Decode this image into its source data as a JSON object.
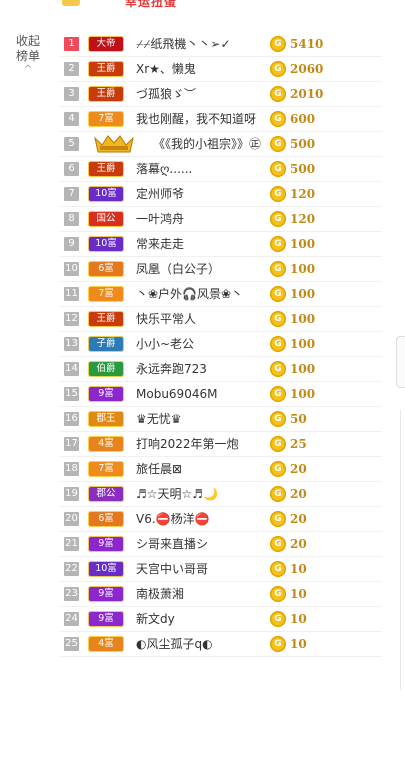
{
  "header": {
    "title": "幸运扭蛋"
  },
  "sidebar": {
    "collapse_label_line1": "收起",
    "collapse_label_line2": "榜单",
    "chevron": "^"
  },
  "coin_glyph": "G",
  "rows": [
    {
      "rank": "1",
      "badge": "大帝",
      "badge_type": "dadi",
      "name": "⌿⌿纸飛機丶丶➢✓",
      "score": "5410"
    },
    {
      "rank": "2",
      "badge": "王爵",
      "badge_type": "wang",
      "name": "Xr★、懒鬼",
      "score": "2060"
    },
    {
      "rank": "3",
      "badge": "王爵",
      "badge_type": "wang",
      "name": "づ孤狼ゞ︶",
      "score": "2010"
    },
    {
      "rank": "4",
      "badge": "7富",
      "badge_type": "fu7",
      "name": "我也刚醒，我不知道呀",
      "score": "600"
    },
    {
      "rank": "5",
      "badge": "",
      "badge_type": "crown",
      "name": "《《我的小祖宗》》㊣",
      "score": "500"
    },
    {
      "rank": "6",
      "badge": "王爵",
      "badge_type": "wang",
      "name": "落幕ღ......",
      "score": "500"
    },
    {
      "rank": "7",
      "badge": "10富",
      "badge_type": "fu10",
      "name": "定州师爷",
      "score": "120"
    },
    {
      "rank": "8",
      "badge": "国公",
      "badge_type": "guo",
      "name": "一叶鸿舟",
      "score": "120"
    },
    {
      "rank": "9",
      "badge": "10富",
      "badge_type": "fu10",
      "name": "常来走走",
      "score": "100"
    },
    {
      "rank": "10",
      "badge": "6富",
      "badge_type": "fu6",
      "name": "凤凰（白公子）",
      "score": "100"
    },
    {
      "rank": "11",
      "badge": "7富",
      "badge_type": "fu7",
      "name": "丶❀户外🎧风景❀丶",
      "score": "100"
    },
    {
      "rank": "12",
      "badge": "王爵",
      "badge_type": "wang",
      "name": "快乐平常人",
      "score": "100"
    },
    {
      "rank": "13",
      "badge": "子爵",
      "badge_type": "zi",
      "name": "小小~老公",
      "score": "100"
    },
    {
      "rank": "14",
      "badge": "伯爵",
      "badge_type": "bo",
      "name": "永远奔跑723",
      "score": "100"
    },
    {
      "rank": "15",
      "badge": "9富",
      "badge_type": "fu9",
      "name": "Mobu69046M",
      "score": "100"
    },
    {
      "rank": "16",
      "badge": "郡王",
      "badge_type": "juw",
      "name": "♛无忧♛",
      "score": "50"
    },
    {
      "rank": "17",
      "badge": "4富",
      "badge_type": "fu4",
      "name": "打响2022年第一炮",
      "score": "25"
    },
    {
      "rank": "18",
      "badge": "7富",
      "badge_type": "fu7",
      "name": "旅任晨⊠",
      "score": "20"
    },
    {
      "rank": "19",
      "badge": "郡公",
      "badge_type": "jug",
      "name": "♬☆天明☆♬🌙",
      "score": "20"
    },
    {
      "rank": "20",
      "badge": "6富",
      "badge_type": "fu6",
      "name": "V6.⛔杨洋⛔",
      "score": "20"
    },
    {
      "rank": "21",
      "badge": "9富",
      "badge_type": "fu9",
      "name": "シ哥来直播シ",
      "score": "20"
    },
    {
      "rank": "22",
      "badge": "10富",
      "badge_type": "fu10",
      "name": "天宫中い哥哥",
      "score": "10"
    },
    {
      "rank": "23",
      "badge": "9富",
      "badge_type": "fu9",
      "name": "南极萧湘",
      "score": "10"
    },
    {
      "rank": "24",
      "badge": "9富",
      "badge_type": "fu9",
      "name": "新文dy",
      "score": "10"
    },
    {
      "rank": "25",
      "badge": "4富",
      "badge_type": "fu4",
      "name": "◐风尘孤子q◐",
      "score": "10"
    }
  ]
}
